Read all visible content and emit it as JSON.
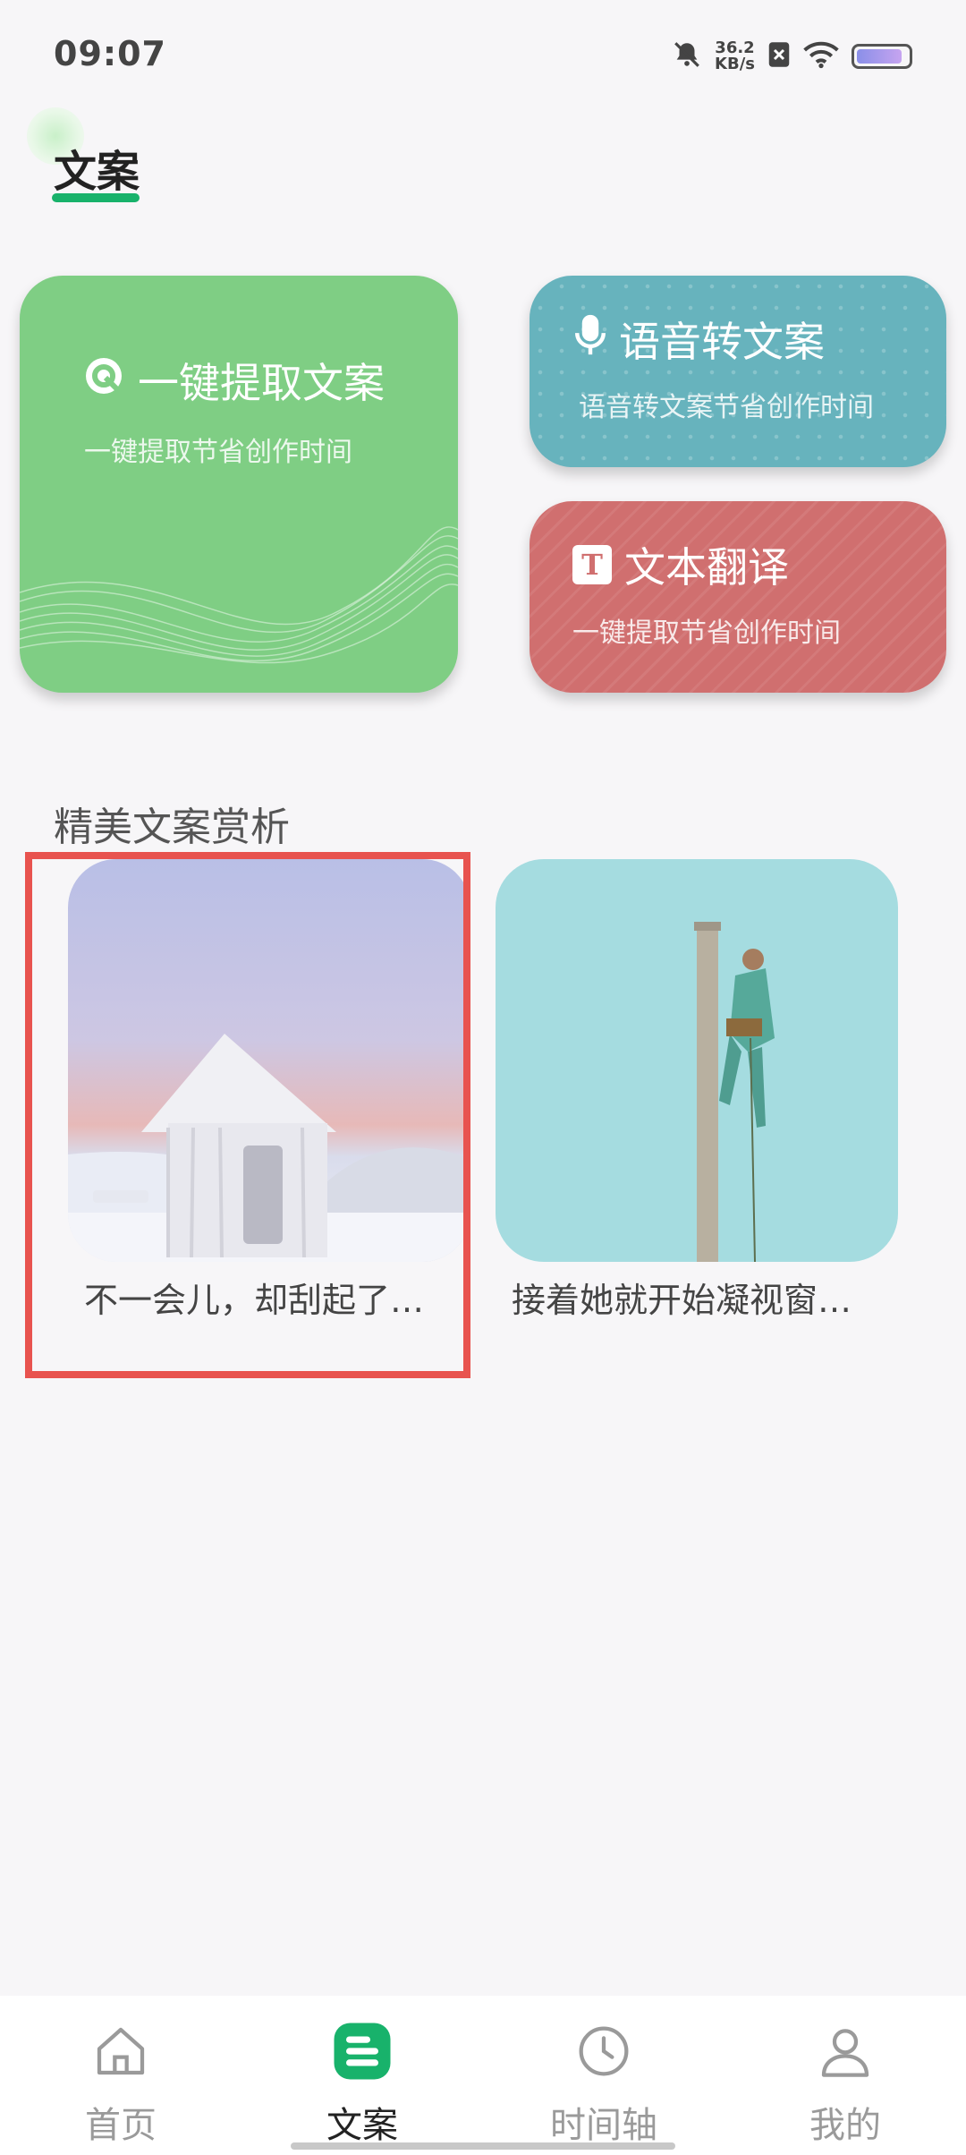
{
  "status_bar": {
    "time": "09:07",
    "net_speed_value": "36.2",
    "net_speed_unit": "KB/s"
  },
  "page": {
    "title": "文案"
  },
  "features": [
    {
      "title": "一键提取文案",
      "subtitle": "一键提取节省创作时间",
      "icon": "link-icon",
      "color": "#7fce84"
    },
    {
      "title": "语音转文案",
      "subtitle": "语音转文案节省创作时间",
      "icon": "microphone-icon",
      "color": "#67b3bd"
    },
    {
      "title": "文本翻译",
      "subtitle": "一键提取节省创作时间",
      "icon": "text-t-icon",
      "icon_letter": "T",
      "color": "#d06f6f"
    }
  ],
  "section": {
    "title": "精美文案赏析"
  },
  "articles": [
    {
      "caption": "不一会儿，却刮起了…"
    },
    {
      "caption": "接着她就开始凝视窗…"
    }
  ],
  "nav": {
    "items": [
      {
        "label": "首页",
        "icon": "home-icon",
        "active": false
      },
      {
        "label": "文案",
        "icon": "document-icon",
        "active": true
      },
      {
        "label": "时间轴",
        "icon": "clock-icon",
        "active": false
      },
      {
        "label": "我的",
        "icon": "user-icon",
        "active": false
      }
    ],
    "active_color": "#18b26b"
  },
  "highlight_color": "#e8534f"
}
